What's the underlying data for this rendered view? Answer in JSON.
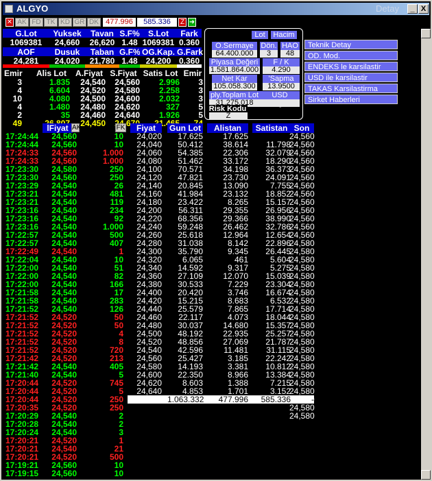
{
  "window": {
    "title": "ALGYO",
    "detail_label": "Detay",
    "minimize": "_",
    "close": "X"
  },
  "toolbar": {
    "buttons": [
      "AK",
      "FD",
      "TK",
      "KD",
      "GR",
      "DK"
    ],
    "value1": "477.996",
    "value2": "585.336",
    "z_label": "Z"
  },
  "summary": {
    "headers1": [
      "G.Lot",
      "Yuksek",
      "Tavan",
      "S.F%",
      "S.Lot",
      "Fark"
    ],
    "values1": [
      "1069381",
      "24,660",
      "26,620",
      "1.48",
      "1069381",
      "0.360"
    ],
    "headers2": [
      "AOF",
      "Dusuk",
      "Taban",
      "G.F%",
      "OG.Kap.",
      "G.Fark"
    ],
    "values2": [
      "24,281",
      "24,020",
      "21,780",
      "1.48",
      "24,200",
      "0.360"
    ]
  },
  "depth": {
    "headers": [
      "Emir",
      "Alis Lot",
      "A.Fiyat",
      "S.Fiyat",
      "Satis Lot",
      "Emir"
    ],
    "rows": [
      [
        "3",
        "1.835",
        "24,540",
        "24,560",
        "2.996",
        "3"
      ],
      [
        "4",
        "6.604",
        "24,520",
        "24,580",
        "2.258",
        "3"
      ],
      [
        "10",
        "4.080",
        "24,500",
        "24,600",
        "2.032",
        "3"
      ],
      [
        "4",
        "1.480",
        "24,480",
        "24,620",
        "327",
        "5"
      ],
      [
        "2",
        "35",
        "24,460",
        "24,640",
        "1.926",
        "5"
      ]
    ],
    "totals": [
      "49",
      "26.807",
      "24,450",
      "24,670",
      "31.465",
      "74"
    ]
  },
  "info_panel": {
    "lot": "Lot",
    "hacim": "Hacim",
    "o_sermaye_label": "O.Sermaye",
    "o_sermaye": "64.400.000",
    "don_label": "Dön.",
    "don": "3",
    "hao_label": "HAO",
    "hao": "48",
    "piyasa_label": "Piyasa Değeri",
    "piyasa": "1.581.864.000",
    "fk_label": "F / K",
    "fk": "4.290",
    "netkar_label": "Net Kar",
    "netkar": "105.058.300",
    "sapma_label": "'Sapma",
    "sapma": "13.9500",
    "ply_label": "ply.Toplam Lot",
    "ply": "31.275.018",
    "usd_label": "USD Değeri",
    "risk_label": "Risk Kodu",
    "risk": "Z"
  },
  "menu": [
    "Teknik Detay",
    "OD. Mod.",
    "ENDEKS le karsilastir",
    "USD ile karsilastir",
    "TAKAS Karsilastirma",
    "Sirket Haberleri"
  ],
  "trades": {
    "headers": [
      "lFiyat",
      "AK",
      "FK"
    ],
    "rows": [
      [
        "17:24:44",
        "24,560",
        "10",
        "g"
      ],
      [
        "17:24:44",
        "24,560",
        "10",
        "g"
      ],
      [
        "17:24:33",
        "24,560",
        "1.000",
        "r"
      ],
      [
        "17:24:33",
        "24,560",
        "1.000",
        "r"
      ],
      [
        "17:23:30",
        "24,580",
        "250",
        "g"
      ],
      [
        "17:23:30",
        "24,560",
        "250",
        "g"
      ],
      [
        "17:23:29",
        "24,540",
        "26",
        "g"
      ],
      [
        "17:23:21",
        "24,540",
        "481",
        "g"
      ],
      [
        "17:23:21",
        "24,540",
        "119",
        "g"
      ],
      [
        "17:23:16",
        "24,540",
        "234",
        "g"
      ],
      [
        "17:23:16",
        "24,540",
        "92",
        "g"
      ],
      [
        "17:23:16",
        "24,540",
        "1.000",
        "g"
      ],
      [
        "17:22:57",
        "24,540",
        "500",
        "g"
      ],
      [
        "17:22:57",
        "24,540",
        "407",
        "g"
      ],
      [
        "17:22:49",
        "24,540",
        "1",
        "r"
      ],
      [
        "17:22:04",
        "24,540",
        "10",
        "g"
      ],
      [
        "17:22:00",
        "24,540",
        "51",
        "g"
      ],
      [
        "17:22:00",
        "24,540",
        "82",
        "g"
      ],
      [
        "17:22:00",
        "24,540",
        "166",
        "g"
      ],
      [
        "17:21:58",
        "24,540",
        "17",
        "g"
      ],
      [
        "17:21:58",
        "24,540",
        "283",
        "g"
      ],
      [
        "17:21:52",
        "24,540",
        "126",
        "g"
      ],
      [
        "17:21:52",
        "24,520",
        "50",
        "r"
      ],
      [
        "17:21:52",
        "24,520",
        "50",
        "r"
      ],
      [
        "17:21:52",
        "24,520",
        "4",
        "r"
      ],
      [
        "17:21:52",
        "24,520",
        "8",
        "r"
      ],
      [
        "17:21:52",
        "24,520",
        "720",
        "r"
      ],
      [
        "17:21:42",
        "24,520",
        "213",
        "r"
      ],
      [
        "17:21:42",
        "24,540",
        "405",
        "g"
      ],
      [
        "17:21:40",
        "24,540",
        "5",
        "g"
      ],
      [
        "17:20:44",
        "24,520",
        "745",
        "r"
      ],
      [
        "17:20:44",
        "24,520",
        "5",
        "r"
      ],
      [
        "17:20:44",
        "24,520",
        "250",
        "r"
      ],
      [
        "17:20:35",
        "24,520",
        "250",
        "r"
      ],
      [
        "17:20:29",
        "24,540",
        "2",
        "g"
      ],
      [
        "17:20:28",
        "24,540",
        "2",
        "g"
      ],
      [
        "17:20:24",
        "24,540",
        "3",
        "g"
      ],
      [
        "17:20:21",
        "24,520",
        "1",
        "r"
      ],
      [
        "17:20:21",
        "24,540",
        "21",
        "r"
      ],
      [
        "17:20:21",
        "24,520",
        "500",
        "r"
      ],
      [
        "17:19:21",
        "24,560",
        "10",
        "g"
      ],
      [
        "17:19:15",
        "24,560",
        "10",
        "g"
      ]
    ]
  },
  "distribution": {
    "headers": [
      "Fiyat",
      "Gun Lot",
      "Alistan",
      "Satistan",
      "Son"
    ],
    "rows": [
      [
        "24,020",
        "17.625",
        "17.625",
        "",
        "24,560"
      ],
      [
        "24,040",
        "50.412",
        "38.614",
        "11.798",
        "24,560"
      ],
      [
        "24,060",
        "54.385",
        "22.306",
        "32.079",
        "24,560"
      ],
      [
        "24,080",
        "51.462",
        "33.172",
        "18.290",
        "24,560"
      ],
      [
        "24,100",
        "70.571",
        "34.198",
        "36.373",
        "24,560"
      ],
      [
        "24,120",
        "47.821",
        "23.730",
        "24.091",
        "24,560"
      ],
      [
        "24,140",
        "20.845",
        "13.090",
        "7.755",
        "24,560"
      ],
      [
        "24,160",
        "41.984",
        "23.132",
        "18.852",
        "24,560"
      ],
      [
        "24,180",
        "23.422",
        "8.265",
        "15.157",
        "24,560"
      ],
      [
        "24,200",
        "56.311",
        "29.355",
        "26.956",
        "24,560"
      ],
      [
        "24,220",
        "68.356",
        "29.366",
        "38.990",
        "24,560"
      ],
      [
        "24,240",
        "59.248",
        "26.462",
        "32.786",
        "24,560"
      ],
      [
        "24,260",
        "25.618",
        "12.964",
        "12.654",
        "24,560"
      ],
      [
        "24,280",
        "31.038",
        "8.142",
        "22.896",
        "24,580"
      ],
      [
        "24,300",
        "35.790",
        "9.345",
        "26.445",
        "24,580"
      ],
      [
        "24,320",
        "6.065",
        "461",
        "5.604",
        "24,580"
      ],
      [
        "24,340",
        "14.592",
        "9.317",
        "5.275",
        "24,580"
      ],
      [
        "24,360",
        "27.109",
        "12.070",
        "15.039",
        "24,580"
      ],
      [
        "24,380",
        "30.533",
        "7.229",
        "23.304",
        "24,580"
      ],
      [
        "24,400",
        "20.420",
        "3.746",
        "16.674",
        "24,580"
      ],
      [
        "24,420",
        "15.215",
        "8.683",
        "6.532",
        "24,580"
      ],
      [
        "24,440",
        "25.579",
        "7.865",
        "17.714",
        "24,580"
      ],
      [
        "24,460",
        "22.117",
        "4.073",
        "18.044",
        "24,580"
      ],
      [
        "24,480",
        "30.037",
        "14.680",
        "15.357",
        "24,580"
      ],
      [
        "24,500",
        "48.192",
        "22.935",
        "25.257",
        "24,580"
      ],
      [
        "24,520",
        "48.856",
        "27.069",
        "21.787",
        "24,580"
      ],
      [
        "24,540",
        "42.596",
        "11.481",
        "31.115",
        "24,580"
      ],
      [
        "24,560",
        "25.427",
        "3.185",
        "22.242",
        "24,580"
      ],
      [
        "24,580",
        "14.193",
        "3.381",
        "10.812",
        "24,580"
      ],
      [
        "24,600",
        "22.350",
        "8.966",
        "13.384",
        "24,580"
      ],
      [
        "24,620",
        "8.603",
        "1.388",
        "7.215",
        "24,580"
      ],
      [
        "24,640",
        "4.853",
        "1.701",
        "3.152",
        "24,580"
      ],
      [
        "24,660",
        "1.707",
        "",
        "1.707",
        "24,580"
      ],
      [
        "",
        "",
        "",
        "",
        "24,580"
      ],
      [
        "",
        "",
        "",
        "",
        "24,580"
      ]
    ],
    "totals": [
      "",
      "1.063.332",
      "477.996",
      "585.336",
      "-"
    ]
  }
}
